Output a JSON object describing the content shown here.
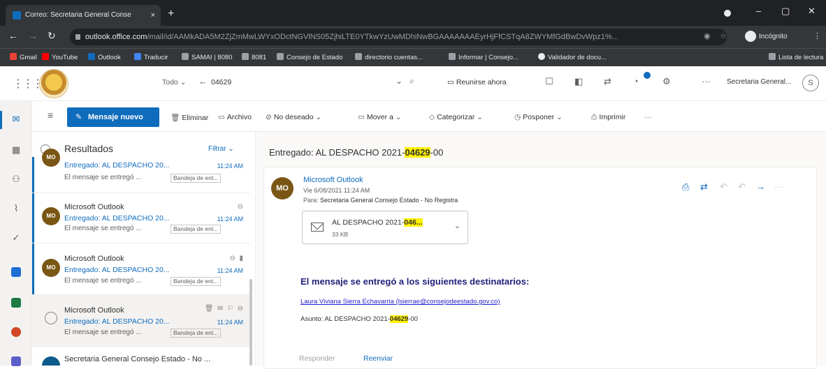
{
  "browser": {
    "tab_title": "Correo: Secretaria General Conse",
    "tab_close": "×",
    "new_tab": "+",
    "url_host": "outlook.office.com",
    "url_path": "/mail/id/AAMkADA5M2ZjZmMwLWYxODctNGVlNS05ZjhiLTE0YTkwYzUwMDhiNwBGAAAAAAAEyrHjFfCSTqA8ZWYMfGdBwDvWpz1%...",
    "incognito_label": "Incógnito",
    "bookmarks": [
      {
        "label": "Gmail",
        "color": "#ea4335"
      },
      {
        "label": "YouTube",
        "color": "#ff0000"
      },
      {
        "label": "Outlook",
        "color": "#0f6cbd"
      },
      {
        "label": "Traducir",
        "color": "#4285f4"
      },
      {
        "label": "SAMAI | 8080",
        "color": "#9aa0a6"
      },
      {
        "label": "8081",
        "color": "#9aa0a6"
      },
      {
        "label": "Consejo de Estado",
        "color": "#9aa0a6"
      },
      {
        "label": "directorio cuentas...",
        "color": "#9aa0a6"
      },
      {
        "label": "Informar | Consejo...",
        "color": "#9aa0a6"
      },
      {
        "label": "Validador de docu...",
        "color": "#e8eaed"
      }
    ],
    "reading_list": "Lista de lectura"
  },
  "header": {
    "scope": "Todo",
    "search_query": "04629",
    "meet_now": "Reunirse ahora",
    "user_name": "Secretaria General...",
    "user_initial": "S"
  },
  "commands": {
    "new_message": "Mensaje nuevo",
    "delete": "Eliminar",
    "archive": "Archivo",
    "junk": "No deseado",
    "move": "Mover a",
    "categorize": "Categorizar",
    "snooze": "Posponer",
    "print": "Imprimir",
    "more": "···"
  },
  "list": {
    "title": "Resultados",
    "filter": "Filtrar",
    "items": [
      {
        "sender": "",
        "subject": "Entregado: AL DESPACHO 20...",
        "preview": "El mensaje se entregó ...",
        "time": "11:24 AM",
        "folder": "Bandeja de ent..."
      },
      {
        "sender": "Microsoft Outlook",
        "subject": "Entregado: AL DESPACHO 20...",
        "preview": "El mensaje se entregó ...",
        "time": "11:24 AM",
        "folder": "Bandeja de ent..."
      },
      {
        "sender": "Microsoft Outlook",
        "subject": "Entregado: AL DESPACHO 20...",
        "preview": "El mensaje se entregó ...",
        "time": "11:24 AM",
        "folder": "Bandeja de ent..."
      },
      {
        "sender": "Microsoft Outlook",
        "subject": "Entregado: AL DESPACHO 20...",
        "preview": "El mensaje se entregó ...",
        "time": "11:24 AM",
        "folder": "Bandeja de ent..."
      },
      {
        "sender": "Secretaria General Consejo Estado - No ...",
        "subject": "",
        "preview": "",
        "time": "",
        "folder": ""
      }
    ],
    "avatar_initials": "MO"
  },
  "message": {
    "subject_prefix": "Entregado: AL DESPACHO 2021-",
    "subject_highlight": "04629",
    "subject_suffix": "-00",
    "from": "Microsoft Outlook",
    "date": "Vie 6/08/2021 11:24 AM",
    "to_label": "Para:",
    "to": "Secretaria General Consejo Estado - No Registra",
    "initials": "MO",
    "attachment_name_prefix": "AL DESPACHO 2021-",
    "attachment_name_highlight": "046...",
    "attachment_size": "33 KB",
    "body_title": "El mensaje se entregó a los siguientes destinatarios:",
    "recipient": "Laura Viviana Sierra Echavarria (lsierrae@consejodeestado.gov.co)",
    "asunto_label": "Asunto: AL DESPACHO 2021-",
    "asunto_highlight": "04629",
    "asunto_suffix": "-00",
    "reply": "Responder",
    "forward": "Reenviar"
  },
  "colors": {
    "accent": "#0f6cbd",
    "highlight": "#fff100",
    "avatar_mo": "#7a5615"
  }
}
